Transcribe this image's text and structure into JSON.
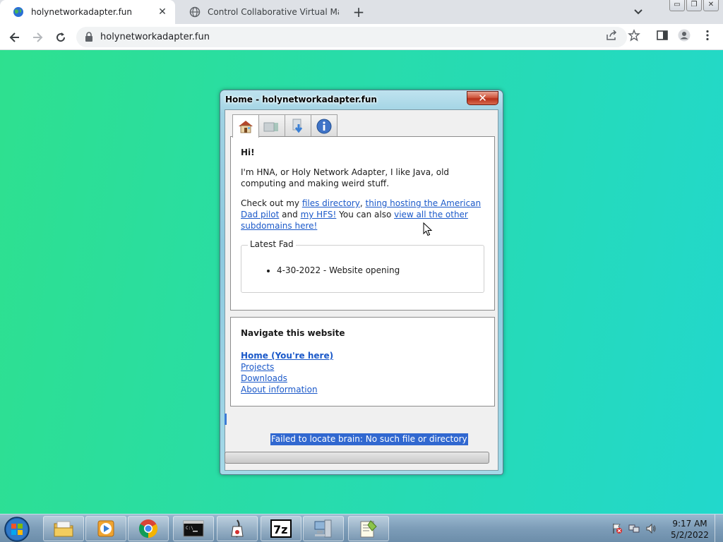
{
  "browser": {
    "tabs": [
      {
        "title": "holynetworkadapter.fun",
        "active": true
      },
      {
        "title": "Control Collaborative Virtual Mac",
        "active": false
      }
    ],
    "new_tab_label": "+",
    "window_controls": {
      "minimize": "▭",
      "restore": "❐",
      "close": "✕"
    },
    "url": "holynetworkadapter.fun"
  },
  "site_window": {
    "title": "Home - holynetworkadapter.fun",
    "close_label": "✕",
    "tabs": [
      {
        "icon": "house-icon",
        "active": true
      },
      {
        "icon": "projects-icon",
        "active": false
      },
      {
        "icon": "download-icon",
        "active": false
      },
      {
        "icon": "info-icon",
        "active": false
      }
    ],
    "main": {
      "greeting": "Hi!",
      "intro": "I'm HNA, or Holy Network Adapter, I like Java, old computing and making weird stuff.",
      "check_prefix": "Check out my ",
      "link_files": "files directory",
      "sep1": ", ",
      "link_american_dad": "thing hosting the American Dad pilot",
      "sep2": " and ",
      "link_hfs": "my HFS!",
      "sep3": " You can also ",
      "link_subdomains": "view all the other subdomains here!",
      "latest_legend": "Latest Fad",
      "latest_items": [
        "4-30-2022 - Website opening"
      ]
    },
    "nav": {
      "heading": "Navigate this website",
      "links": [
        {
          "label": "Home (You're here)",
          "current": true
        },
        {
          "label": "Projects",
          "current": false
        },
        {
          "label": "Downloads",
          "current": false
        },
        {
          "label": "About information",
          "current": false
        }
      ]
    },
    "status_text": "Failed to locate brain: No such file or directory"
  },
  "taskbar": {
    "apps": [
      "file-explorer-icon",
      "media-player-icon",
      "chrome-icon",
      "command-prompt-icon",
      "java-icon",
      "7zip-icon",
      "network-computer-icon",
      "notepad-plus-icon"
    ],
    "clock_time": "9:17 AM",
    "clock_date": "5/2/2022"
  },
  "colors": {
    "page_background_from": "#2ee08f",
    "page_background_to": "#22d8cc",
    "link": "#1b59c9",
    "selection": "#3168d0"
  }
}
